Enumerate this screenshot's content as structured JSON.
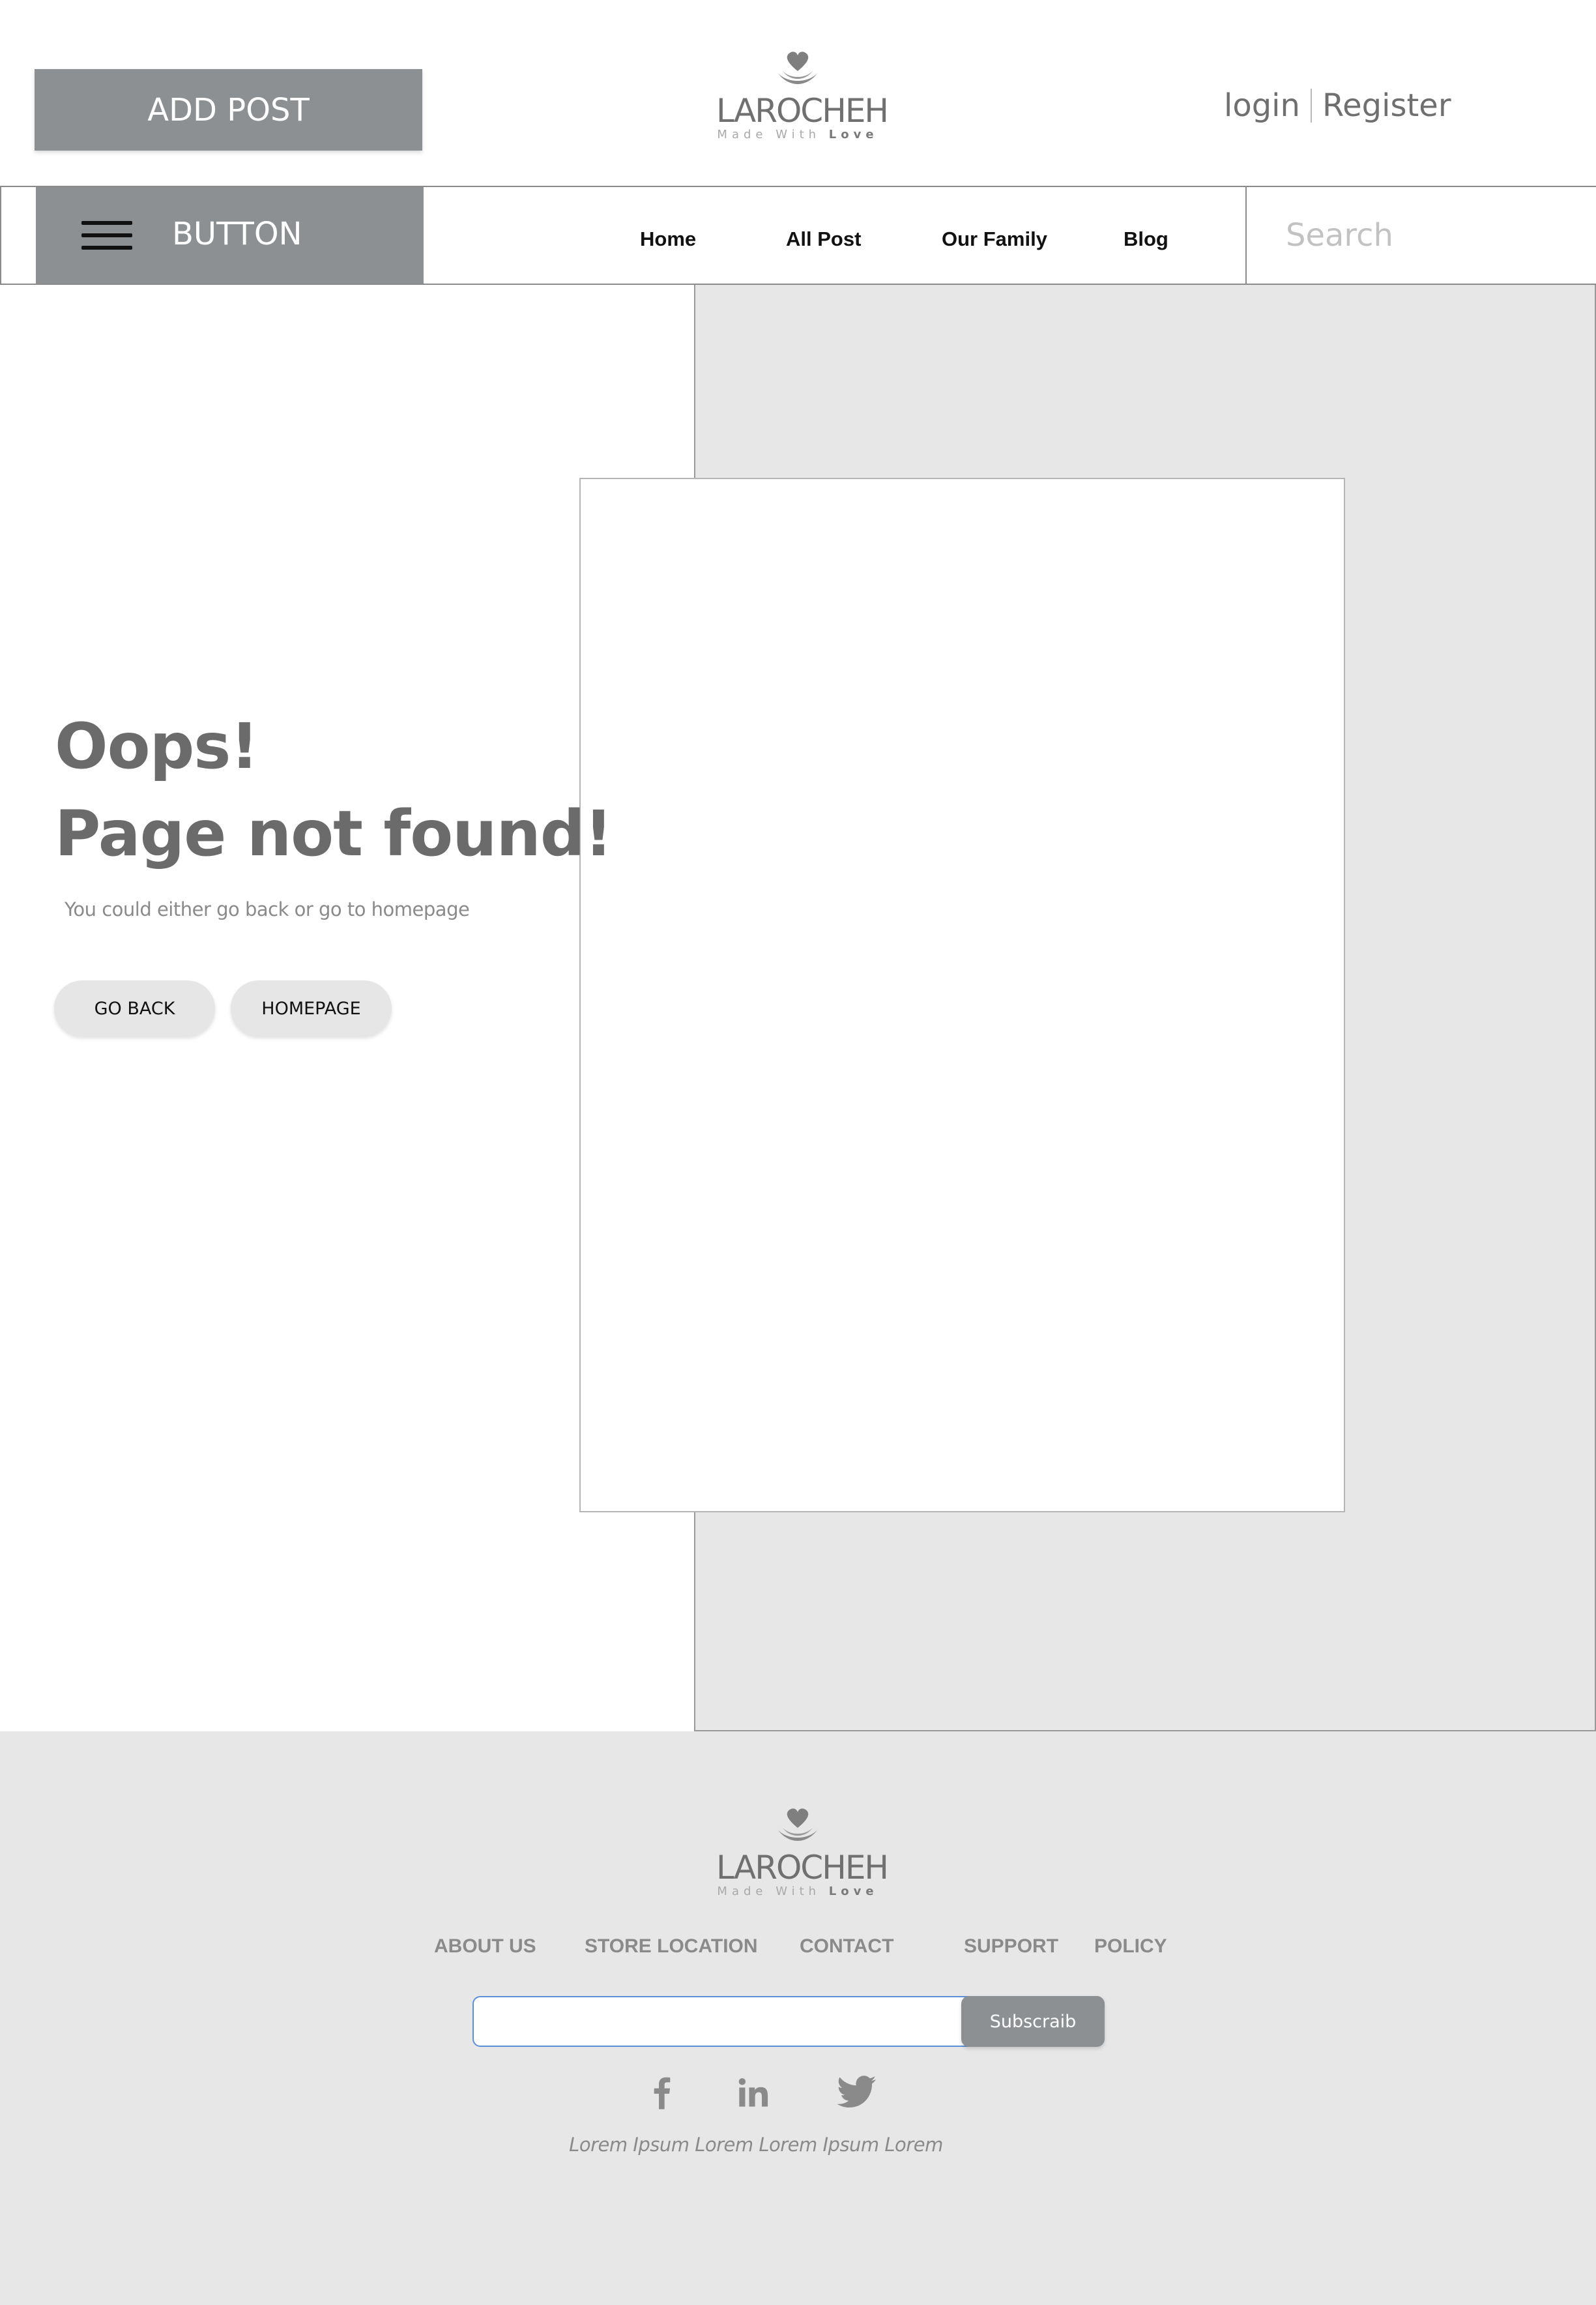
{
  "header": {
    "add_post_label": "ADD POST",
    "logo": {
      "name": "LAROCHEH",
      "tagline_prefix": "Made With ",
      "tagline_emphasis": "Love"
    },
    "login_label": "login",
    "register_label": "Register"
  },
  "navbar": {
    "menu_button_label": "BUTTON",
    "links": [
      "Home",
      "All Post",
      "Our Family",
      "Blog"
    ],
    "search_placeholder": "Search"
  },
  "error": {
    "heading_line1": "Oops!",
    "heading_line2": "Page not found!",
    "subtitle": "You could either go back or go to homepage",
    "go_back_label": "GO BACK",
    "homepage_label": "HOMEPAGE"
  },
  "footer": {
    "logo": {
      "name": "LAROCHEH",
      "tagline_prefix": "Made With ",
      "tagline_emphasis": "Love"
    },
    "links": [
      "ABOUT US",
      "STORE LOCATION",
      "CONTACT",
      "SUPPORT",
      "POLICY"
    ],
    "newsletter": {
      "value": "",
      "button_label": "Subscraib"
    },
    "social_icons": [
      "facebook-icon",
      "linkedin-icon",
      "twitter-icon"
    ],
    "note": "Lorem Ipsum Lorem Lorem Ipsum Lorem"
  },
  "colors": {
    "button_gray": "#8d9093",
    "panel_gray": "#e7e7e7",
    "heading_gray": "#6b6b6b",
    "input_focus_blue": "#5b8fd8"
  }
}
